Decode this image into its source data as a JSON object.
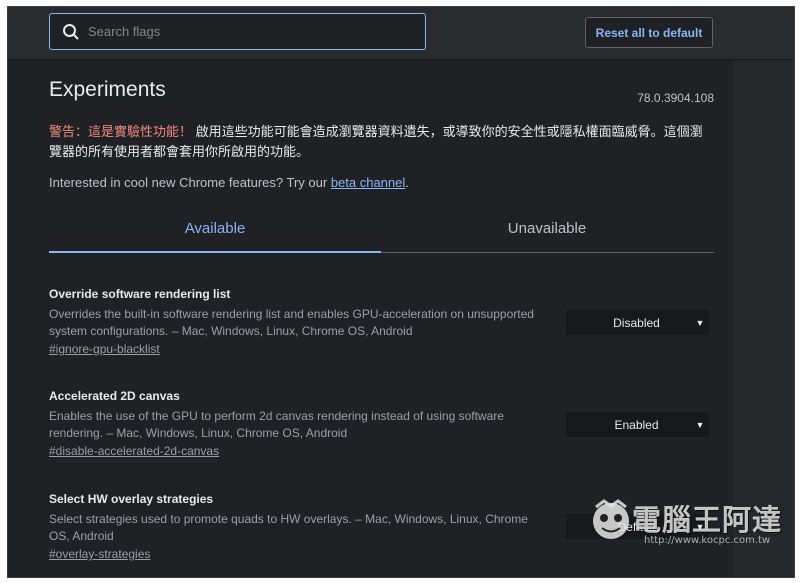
{
  "search": {
    "placeholder": "Search flags",
    "value": ""
  },
  "header": {
    "reset_label": "Reset all to default"
  },
  "page": {
    "title": "Experiments",
    "version": "78.0.3904.108",
    "warning_prefix": "警告：這是實驗性功能！",
    "warning_text": "啟用這些功能可能會造成瀏覽器資料遺失，或導致你的安全性或隱私權面臨威脅。這個瀏覽器的所有使用者都會套用你所啟用的功能。",
    "interested_text": "Interested in cool new Chrome features? Try our ",
    "beta_link": "beta channel",
    "interested_suffix": "."
  },
  "tabs": [
    {
      "label": "Available",
      "active": true
    },
    {
      "label": "Unavailable",
      "active": false
    }
  ],
  "flags": [
    {
      "title": "Override software rendering list",
      "description": "Overrides the built-in software rendering list and enables GPU-acceleration on unsupported system configurations. – Mac, Windows, Linux, Chrome OS, Android",
      "link": "#ignore-gpu-blacklist",
      "value": "Disabled"
    },
    {
      "title": "Accelerated 2D canvas",
      "description": "Enables the use of the GPU to perform 2d canvas rendering instead of using software rendering. – Mac, Windows, Linux, Chrome OS, Android",
      "link": "#disable-accelerated-2d-canvas",
      "value": "Enabled"
    },
    {
      "title": "Select HW overlay strategies",
      "description": "Select strategies used to promote quads to HW overlays. – Mac, Windows, Linux, Chrome OS, Android",
      "link": "#overlay-strategies",
      "value": "Default"
    }
  ],
  "watermark": {
    "text": "電腦王阿達",
    "url": "http://www.kocpc.com.tw"
  },
  "colors": {
    "accent": "#8ab4f8",
    "background": "#202124",
    "warning": "#f28b82"
  }
}
